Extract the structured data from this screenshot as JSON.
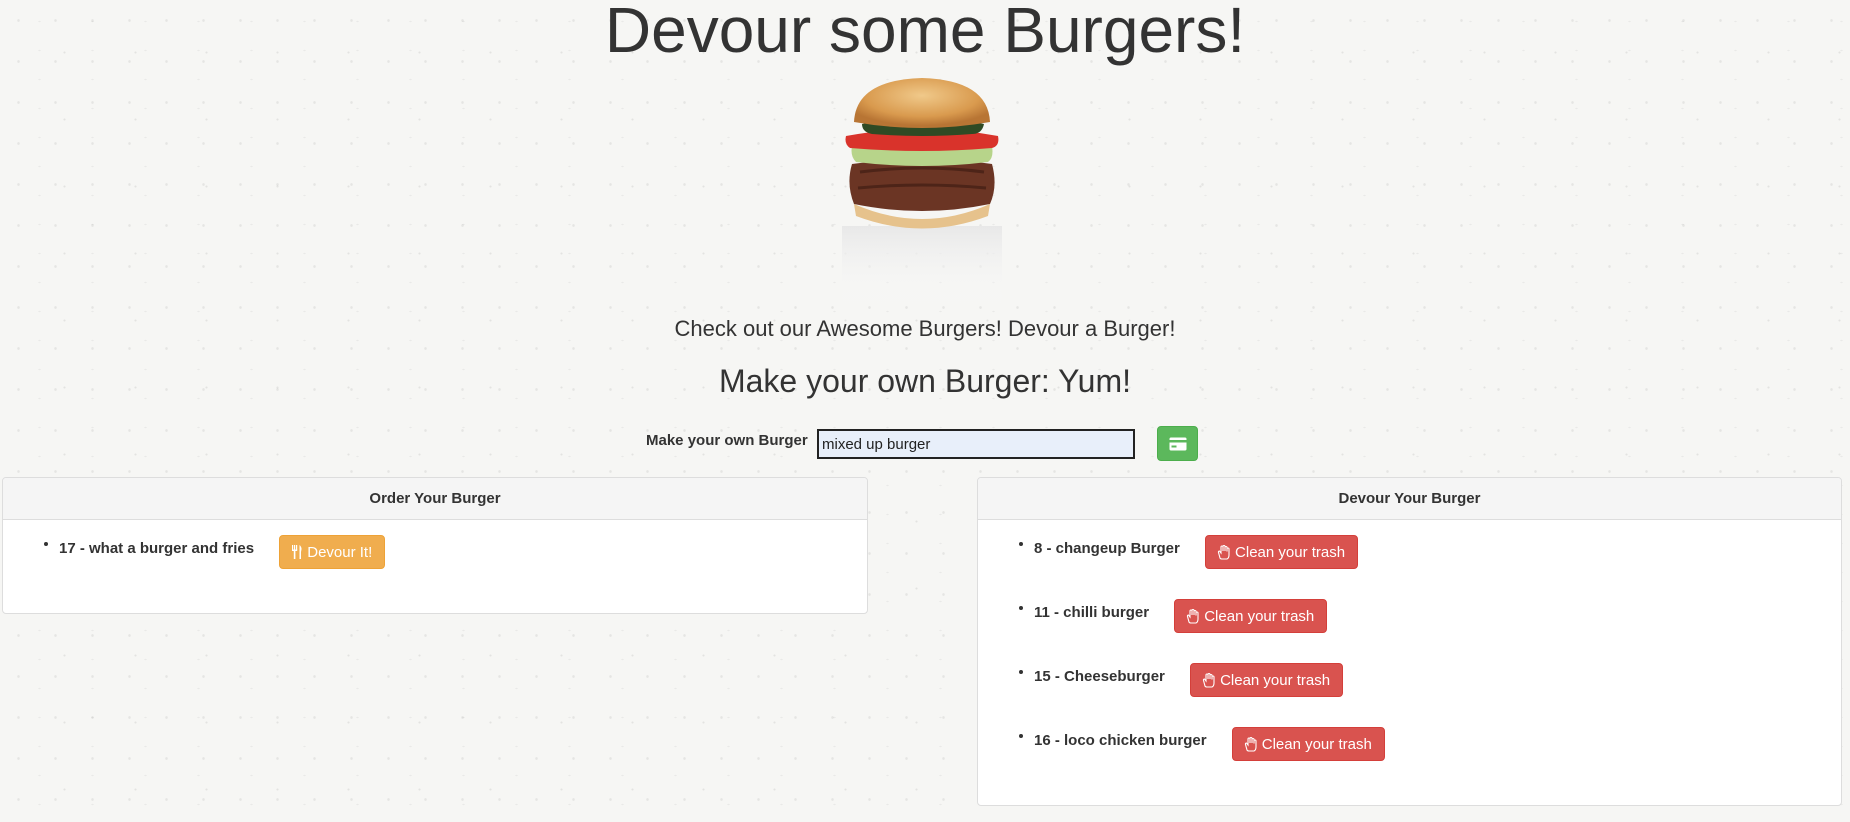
{
  "page": {
    "title": "Devour some Burgers!",
    "tagline": "Check out our Awesome Burgers! Devour a Burger!",
    "section_title": "Make your own Burger: Yum!"
  },
  "form": {
    "label": "Make your own Burger",
    "input_value": "mixed up burger",
    "submit_icon": "credit-card-icon",
    "submit_color": "#5cb85c"
  },
  "order_panel": {
    "heading": "Order Your Burger",
    "items": [
      {
        "label": "17 - what a burger and fries",
        "button_label": "Devour It!",
        "button_icon": "cutlery-icon"
      }
    ],
    "button_color": "#f0ad4e"
  },
  "devour_panel": {
    "heading": "Devour Your Burger",
    "items": [
      {
        "label": "8 - changeup Burger",
        "button_label": "Clean your trash",
        "button_icon": "hand-icon"
      },
      {
        "label": "11 - chilli burger",
        "button_label": "Clean your trash",
        "button_icon": "hand-icon"
      },
      {
        "label": "15 - Cheeseburger",
        "button_label": "Clean your trash",
        "button_icon": "hand-icon"
      },
      {
        "label": "16 - loco chicken burger",
        "button_label": "Clean your trash",
        "button_icon": "hand-icon"
      }
    ],
    "button_color": "#d9534f"
  }
}
